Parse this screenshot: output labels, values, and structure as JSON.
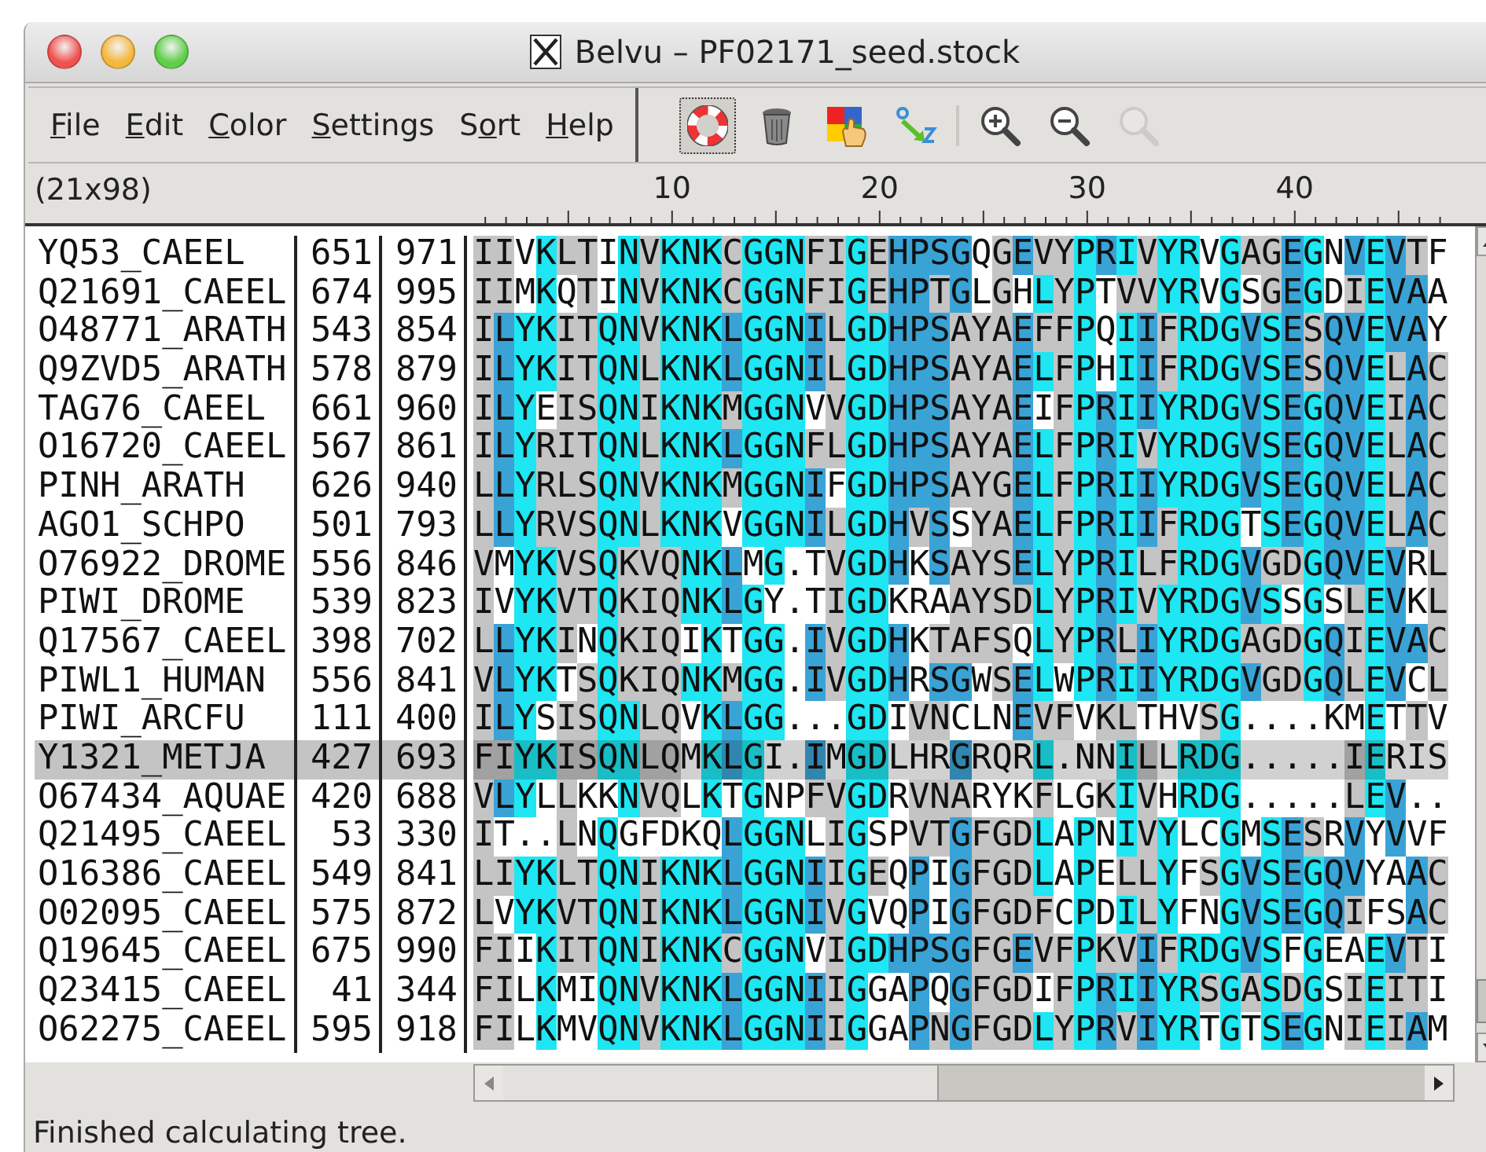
{
  "window": {
    "title": "Belvu – PF02171_seed.stock"
  },
  "menu": [
    {
      "key": "F",
      "after": "ile"
    },
    {
      "key": "E",
      "after": "dit"
    },
    {
      "key": "C",
      "after": "olor"
    },
    {
      "key": "S",
      "after": "ettings"
    },
    {
      "before": "S",
      "key": "o",
      "after": "rt"
    },
    {
      "key": "H",
      "after": "elp"
    }
  ],
  "toolbar": [
    {
      "kind": "lifebuoy",
      "selected": true,
      "disabled": false
    },
    {
      "kind": "trash",
      "selected": false,
      "disabled": false
    },
    {
      "kind": "palette",
      "selected": false,
      "disabled": false
    },
    {
      "kind": "sort",
      "selected": false,
      "disabled": false
    },
    {
      "kind": "separator"
    },
    {
      "kind": "zoom_in",
      "selected": false,
      "disabled": false
    },
    {
      "kind": "zoom_out",
      "selected": false,
      "disabled": false
    },
    {
      "kind": "zoom",
      "selected": false,
      "disabled": true
    }
  ],
  "ruler": {
    "dimensions": "(21x98)",
    "ticks": [
      "10",
      "20",
      "30",
      "40"
    ]
  },
  "rows": [
    {
      "name": "YQ53_CAEEL",
      "start": "651",
      "end": "971",
      "sequence": "IIVKLTINVKNKCGGNFIGEHPSGQGEVYPRIVYRVGAGEGNVEVTF",
      "selected": false
    },
    {
      "name": "Q21691_CAEEL",
      "start": "674",
      "end": "995",
      "sequence": "IIMKQTINVKNKCGGNFIGEHPTGLGHLYPTVVYRVGSGEGDIEVAA",
      "selected": false
    },
    {
      "name": "O48771_ARATH",
      "start": "543",
      "end": "854",
      "sequence": "ILYKITQNVKNKLGGNILGDHPSAYAEFFPQIIFRDGVSESQVEVAY",
      "selected": false
    },
    {
      "name": "Q9ZVD5_ARATH",
      "start": "578",
      "end": "879",
      "sequence": "ILYKITQNLKNKLGGNILGDHPSAYAELFPHIIFRDGVSESQVELAC",
      "selected": false
    },
    {
      "name": "TAG76_CAEEL",
      "start": "661",
      "end": "960",
      "sequence": "ILYEISQNIKNKMGGNVVGDHPSAYAEIFPRIIYRDGVSEGQVEIAC",
      "selected": false
    },
    {
      "name": "O16720_CAEEL",
      "start": "567",
      "end": "861",
      "sequence": "ILYRITQNLKNKLGGNFLGDHPSAYAELFPRIVYRDGVSEGQVELAC",
      "selected": false
    },
    {
      "name": "PINH_ARATH",
      "start": "626",
      "end": "940",
      "sequence": "LLYRLSQNVKNKMGGNIFGDHPSAYGELFPRIIYRDGVSEGQVELAC",
      "selected": false
    },
    {
      "name": "AGO1_SCHPO",
      "start": "501",
      "end": "793",
      "sequence": "LLYRVSQNLKNKVGGNILGDHVSSYAELFPRIIFRDGTSEGQVELAC",
      "selected": false
    },
    {
      "name": "O76922_DROME",
      "start": "556",
      "end": "846",
      "sequence": "VMYKVSQKVQNKLMG.TVGDHKSAYSELYPRILFRDGVGDGQVEVRL",
      "selected": false
    },
    {
      "name": "PIWI_DROME",
      "start": "539",
      "end": "823",
      "sequence": "IVYKVTQKIQNKLGY.TIGDKRAAYSDLYPRIVYRDGVSSGSLEVKL",
      "selected": false
    },
    {
      "name": "Q17567_CAEEL",
      "start": "398",
      "end": "702",
      "sequence": "LLYKINQKIQIKTGG.IVGDHKTAFSQLYPRLIYRDGAGDGQIEVAC",
      "selected": false
    },
    {
      "name": "PIWL1_HUMAN",
      "start": "556",
      "end": "841",
      "sequence": "VLYKTSQKIQNKMGG.IVGDHRSGWSELWPRIIYRDGVGDGQLEVCL",
      "selected": false
    },
    {
      "name": "PIWI_ARCFU",
      "start": "111",
      "end": "400",
      "sequence": "ILYSISQNLQVKLGG...GDIVNCLNEVFVKLTHVSG....KMETTV",
      "selected": false
    },
    {
      "name": "Y1321_METJA",
      "start": "427",
      "end": "693",
      "sequence": "FIYKISQNLQMKLGI.IMGDLHRGRQRL.NNILLRDG.....IERIS",
      "selected": true
    },
    {
      "name": "O67434_AQUAE",
      "start": "420",
      "end": "688",
      "sequence": "VLYLLKKNVQLKTGNPFVGDRVNARYKFLGKIVHRDG.....LEV..",
      "selected": false
    },
    {
      "name": "Q21495_CAEEL",
      "start": "53",
      "end": "330",
      "sequence": "IT..LNQGFDKQLGGNLIGSPVTGFGDLAPNIVYLCGMSESRVYVVF",
      "selected": false
    },
    {
      "name": "O16386_CAEEL",
      "start": "549",
      "end": "841",
      "sequence": "LIYKLTQNIKNKLGGNIIGEQPIGFGDLAPELLYFSGVSEGQVYAAC",
      "selected": false
    },
    {
      "name": "O02095_CAEEL",
      "start": "575",
      "end": "872",
      "sequence": "LVYKVTQNIKNKLGGNIVGVQPIGFGDFCPDILYFNGVSEGQIFSAC",
      "selected": false
    },
    {
      "name": "Q19645_CAEEL",
      "start": "675",
      "end": "990",
      "sequence": "FIIKITQNIKNKCGGNVIGDHPSGFGEVFPKVIFRDGVSFGEAEVTI",
      "selected": false
    },
    {
      "name": "Q23415_CAEEL",
      "start": "41",
      "end": "344",
      "sequence": "FILKMIQNVKNKLGGNIIGGAPQGFGDIFPRIIYRSGASDGSIEITI",
      "selected": false
    },
    {
      "name": "O62275_CAEEL",
      "start": "595",
      "end": "918",
      "sequence": "FILKMVQNVKNKLGGNIIGGAPNGFGDLYPRVIYRTGTSEGNIEIAM",
      "selected": false
    }
  ],
  "status_bar": "Finished calculating tree."
}
